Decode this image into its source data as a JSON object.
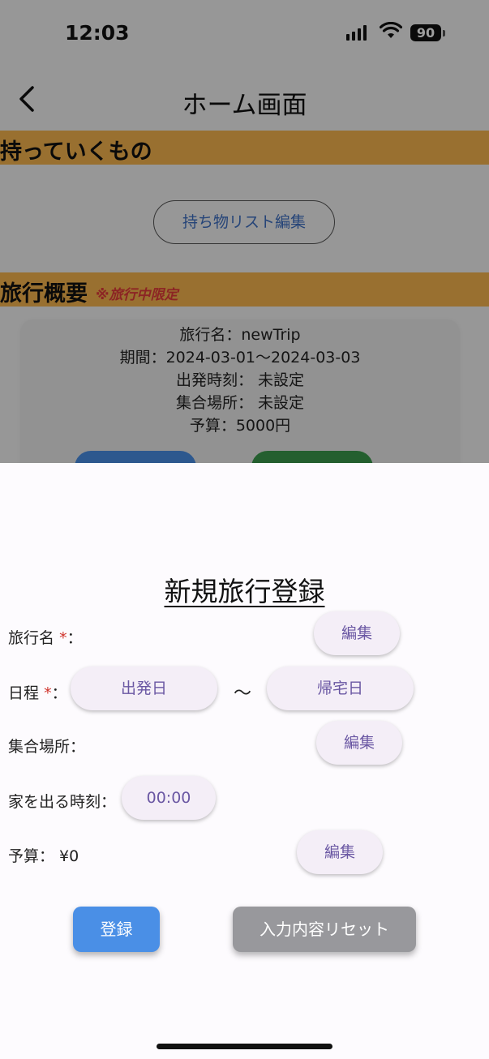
{
  "status_bar": {
    "time": "12:03",
    "battery": "90"
  },
  "nav": {
    "title": "ホーム画面"
  },
  "sections": {
    "packing_title": "持っていくもの",
    "packing_button": "持ち物リスト編集",
    "overview_title": "旅行概要",
    "overview_note": "※旅行中限定"
  },
  "summary": {
    "name_line": "旅行名：newTrip",
    "period_line": "期間：2024-03-01〜2024-03-03",
    "departure_line": "出発時刻：  未設定",
    "meeting_line": "集合場所：  未設定",
    "budget_line": "予算：5000円"
  },
  "sheet": {
    "title": "新規旅行登録",
    "trip_name_label": "旅行名",
    "required_mark": "*",
    "colon": "：",
    "schedule_label": "日程",
    "meeting_place_label": "集合場所：",
    "leave_time_label": "家を出る時刻：",
    "budget_label": "予算：  ¥0",
    "edit_label": "編集",
    "departure_date_label": "出発日",
    "return_date_label": "帰宅日",
    "tilde": "〜",
    "leave_time_value": "00:00",
    "register_label": "登録",
    "reset_label": "入力内容リセット"
  },
  "colors": {
    "section_header": "#f7b54e",
    "accent_blue": "#4a8fe6",
    "pill_text": "#6a57a3",
    "required": "#d0342c",
    "reset_gray": "#98989c"
  }
}
